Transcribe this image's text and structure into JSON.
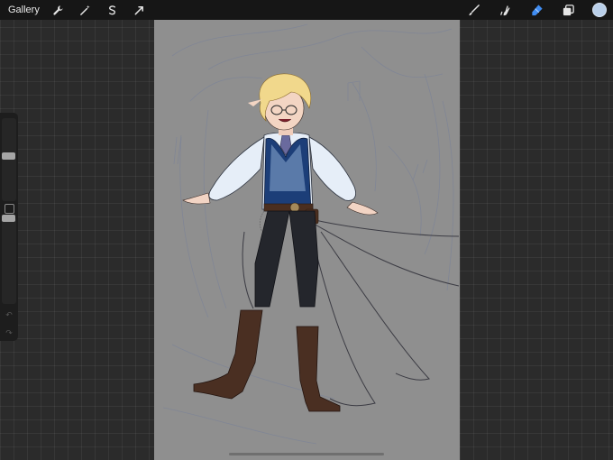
{
  "topbar": {
    "gallery_label": "Gallery",
    "left_tools": [
      "wrench-icon",
      "magic-wand-icon",
      "selection-icon",
      "transform-arrow-icon"
    ],
    "right_tools": [
      "brush-icon",
      "smudge-icon",
      "eraser-icon",
      "layers-icon",
      "color-swatch"
    ],
    "active_tool": "eraser-icon",
    "current_color": "#b9cfe9"
  },
  "sidebar": {
    "brush_size_level": 0.55,
    "opacity_level": 0.35
  },
  "canvas": {
    "background_color": "#8f8f8f",
    "artwork": "character-illustration"
  }
}
